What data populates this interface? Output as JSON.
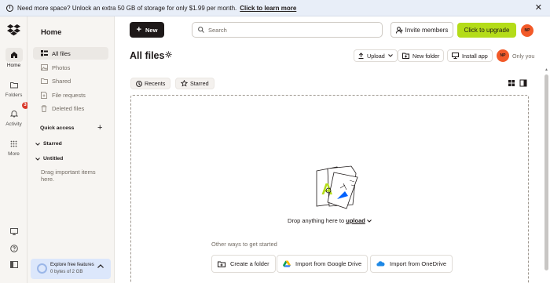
{
  "banner": {
    "message": "Need more space? Unlock an extra 50 GB of storage for only $1.99 per month.",
    "link": "Click to learn more",
    "close": "✕"
  },
  "rail": {
    "items": [
      {
        "label": "Home",
        "icon": "home-icon"
      },
      {
        "label": "Folders",
        "icon": "folder-icon"
      },
      {
        "label": "Activity",
        "icon": "bell-icon",
        "badge": "3"
      },
      {
        "label": "More",
        "icon": "grid-icon"
      }
    ]
  },
  "sidebar": {
    "title": "Home",
    "items": [
      {
        "label": "All files",
        "icon": "files-icon"
      },
      {
        "label": "Photos",
        "icon": "photo-icon"
      },
      {
        "label": "Shared",
        "icon": "shared-icon"
      },
      {
        "label": "File requests",
        "icon": "file-request-icon"
      },
      {
        "label": "Deleted files",
        "icon": "trash-icon"
      }
    ],
    "quick_access": "Quick access",
    "starred": "Starred",
    "untitled": "Untitled",
    "hint": "Drag important items here.",
    "explore_title": "Explore free features",
    "explore_usage": "0 bytes of 2 GB"
  },
  "header": {
    "new_label": "New",
    "search_placeholder": "Search",
    "invite_label": "Invite members",
    "upgrade_label": "Click to upgrade",
    "avatar_initials": "NP"
  },
  "main": {
    "title": "All files",
    "upload_label": "Upload",
    "new_folder_label": "New folder",
    "install_label": "Install app",
    "access_label": "Only you",
    "tabs": [
      "Recents",
      "Starred"
    ],
    "drop_text": "Drop anything here to",
    "drop_link": "upload",
    "other_ways": "Other ways to get started",
    "actions": [
      "Create a folder",
      "Import from Google Drive",
      "Import from OneDrive"
    ]
  },
  "colors": {
    "upgrade": "#b4dc19",
    "avatar": "#f25a29",
    "badge": "#d93a2b",
    "banner": "#e8eef8"
  }
}
